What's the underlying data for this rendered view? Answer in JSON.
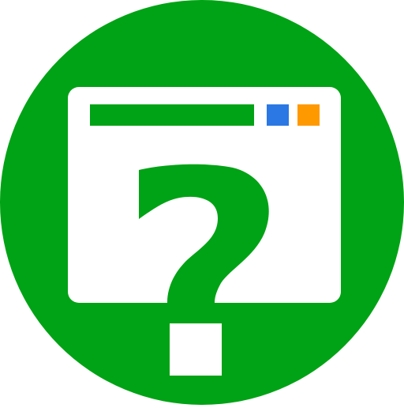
{
  "icon": {
    "name": "window-question-icon",
    "colors": {
      "circle": "#00a315",
      "window": "#ffffff",
      "title_bar": "#00a315",
      "blue_square": "#2b78e4",
      "orange_square": "#ff9900",
      "question_mark": "#00a315",
      "dot": "#ffffff"
    }
  }
}
